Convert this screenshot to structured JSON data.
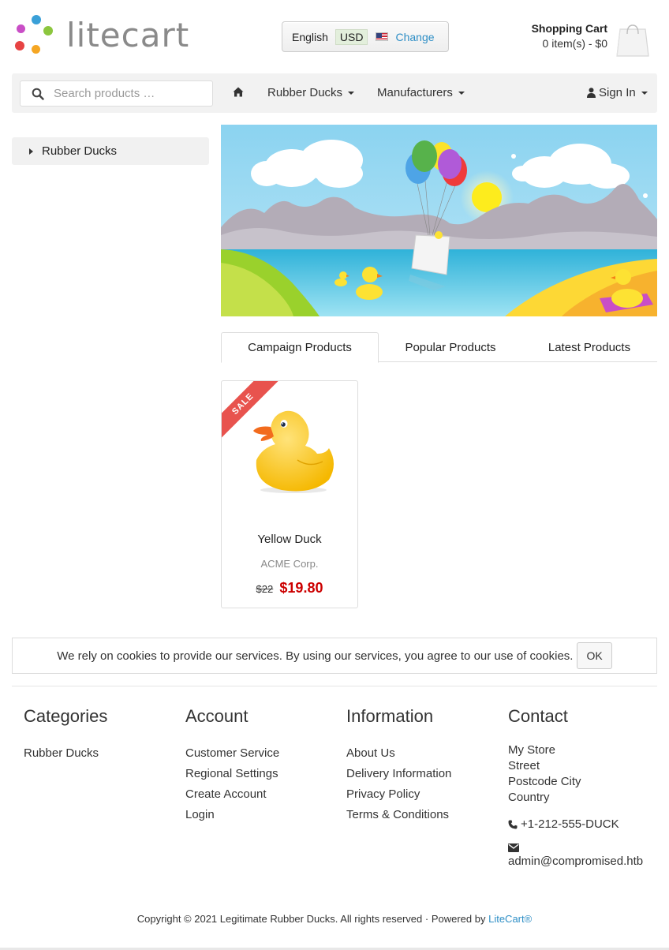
{
  "header": {
    "logo_text": "litecart",
    "region": {
      "language": "English",
      "currency": "USD",
      "change_label": "Change"
    },
    "cart": {
      "title": "Shopping Cart",
      "status": "0 item(s) - $0"
    }
  },
  "navbar": {
    "search_placeholder": "Search products …",
    "items": [
      {
        "label": "Rubber Ducks"
      },
      {
        "label": "Manufacturers"
      }
    ],
    "sign_in": "Sign In"
  },
  "sidebar": {
    "items": [
      {
        "label": "Rubber Ducks"
      }
    ]
  },
  "tabs": [
    {
      "label": "Campaign Products",
      "active": true
    },
    {
      "label": "Popular Products",
      "active": false
    },
    {
      "label": "Latest Products",
      "active": false
    }
  ],
  "products": [
    {
      "sticker": "SALE",
      "name": "Yellow Duck",
      "manufacturer": "ACME Corp.",
      "regular_price": "$22",
      "campaign_price": "$19.80"
    }
  ],
  "cookie_notice": {
    "text": "We rely on cookies to provide our services. By using our services, you agree to our use of cookies.",
    "ok_label": "OK"
  },
  "footer": {
    "categories": {
      "title": "Categories",
      "links": [
        "Rubber Ducks"
      ]
    },
    "account": {
      "title": "Account",
      "links": [
        "Customer Service",
        "Regional Settings",
        "Create Account",
        "Login"
      ]
    },
    "information": {
      "title": "Information",
      "links": [
        "About Us",
        "Delivery Information",
        "Privacy Policy",
        "Terms & Conditions"
      ]
    },
    "contact": {
      "title": "Contact",
      "address": [
        "My Store",
        "Street",
        "Postcode City",
        "Country"
      ],
      "phone": "+1-212-555-DUCK",
      "email": "admin@compromised.htb"
    },
    "copyright": "Copyright © 2021 Legitimate Rubber Ducks. All rights reserved · Powered by ",
    "powered_by": "LiteCart®"
  },
  "colors": {
    "link": "#2f8fc6",
    "sale_badge": "#e8534e",
    "price": "#cc0000"
  }
}
